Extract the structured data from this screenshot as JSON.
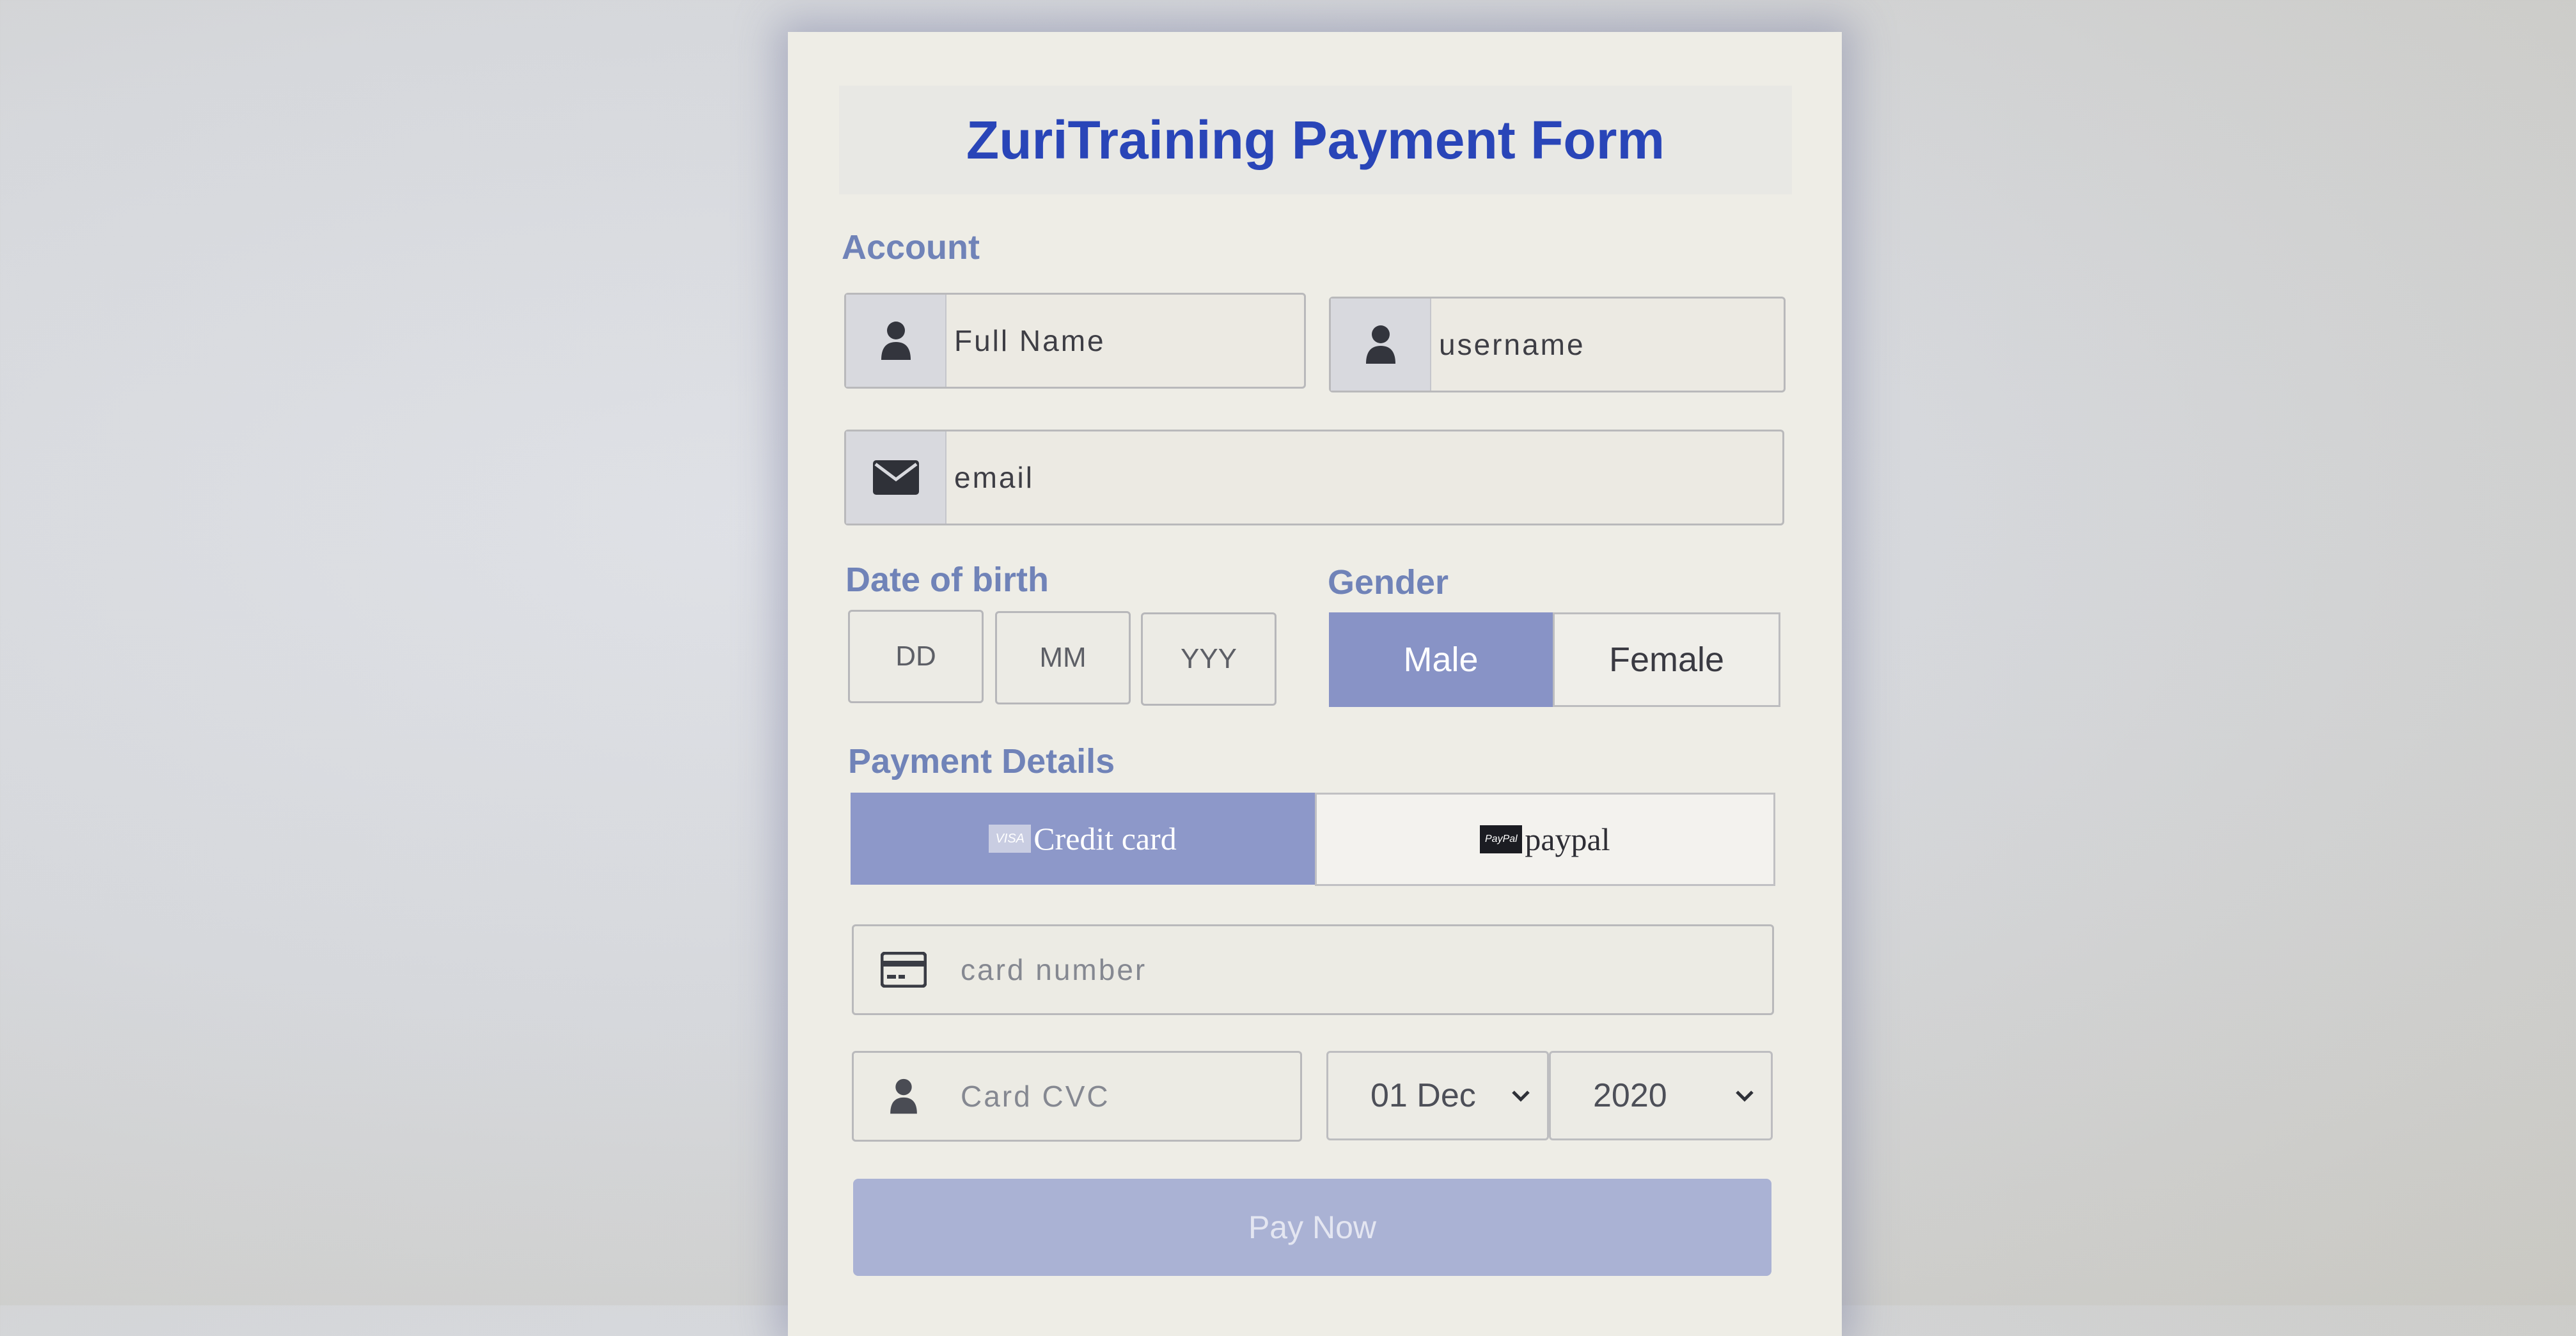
{
  "title": "ZuriTraining Payment Form",
  "account": {
    "label": "Account",
    "full_name_placeholder": "Full Name",
    "username_placeholder": "username",
    "email_placeholder": "email"
  },
  "dob": {
    "label": "Date of birth",
    "day_placeholder": "DD",
    "month_placeholder": "MM",
    "year_placeholder": "YYY"
  },
  "gender": {
    "label": "Gender",
    "options": [
      "Male",
      "Female"
    ],
    "selected": "Male"
  },
  "payment": {
    "label": "Payment Details",
    "methods": [
      {
        "label": "Credit card",
        "badge": "VISA",
        "selected": true
      },
      {
        "label": "paypal",
        "badge": "PayPal",
        "selected": false
      }
    ],
    "card_number_placeholder": "card number",
    "cvc_placeholder": "Card CVC",
    "expiry_month": "01 Dec",
    "expiry_year": "2020"
  },
  "submit_label": "Pay Now",
  "icons": {
    "user": "user-icon",
    "email": "envelope-icon",
    "card": "credit-card-icon",
    "chevron": "chevron-down-icon"
  },
  "colors": {
    "title": "#2945b8",
    "section_label": "#7083b8",
    "accent": "#8893c6",
    "button": "#aab2d4"
  }
}
